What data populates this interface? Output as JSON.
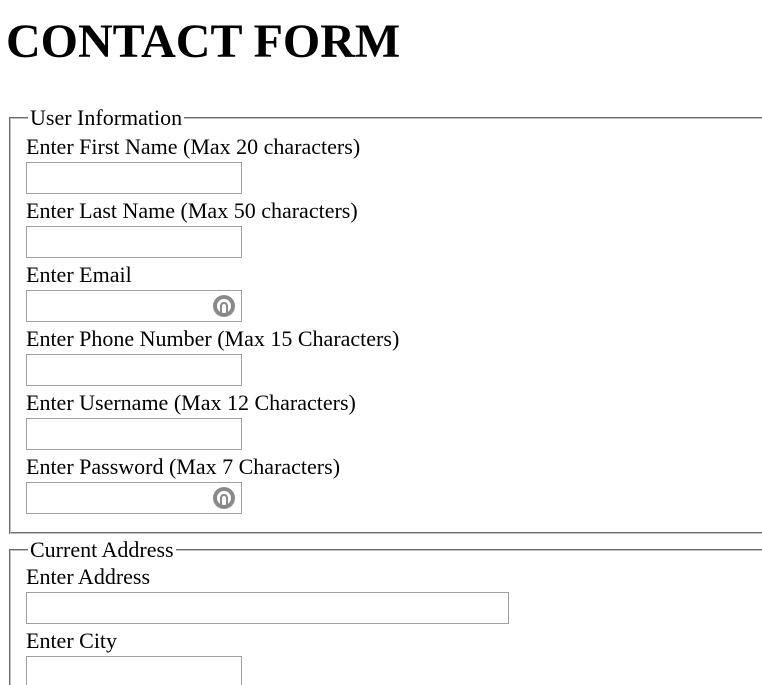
{
  "page": {
    "title": "CONTACT FORM"
  },
  "user_info": {
    "legend": "User Information",
    "fields": [
      {
        "label": "Enter First Name (Max 20 characters)",
        "value": ""
      },
      {
        "label": "Enter Last Name (Max 50 characters)",
        "value": ""
      },
      {
        "label": "Enter Email",
        "value": "",
        "icon": "password-manager-key-icon"
      },
      {
        "label": "Enter Phone Number (Max 15 Characters)",
        "value": ""
      },
      {
        "label": "Enter Username (Max 12 Characters)",
        "value": ""
      },
      {
        "label": "Enter Password (Max 7 Characters)",
        "value": "",
        "icon": "password-manager-key-icon"
      }
    ]
  },
  "current_address": {
    "legend": "Current Address",
    "fields": [
      {
        "label": "Enter Address",
        "value": ""
      },
      {
        "label": "Enter City",
        "value": ""
      }
    ]
  },
  "colors": {
    "input_border": "#a0a0a0",
    "fieldset_border": "#c0c0c0",
    "icon": "#8a8a8a"
  }
}
